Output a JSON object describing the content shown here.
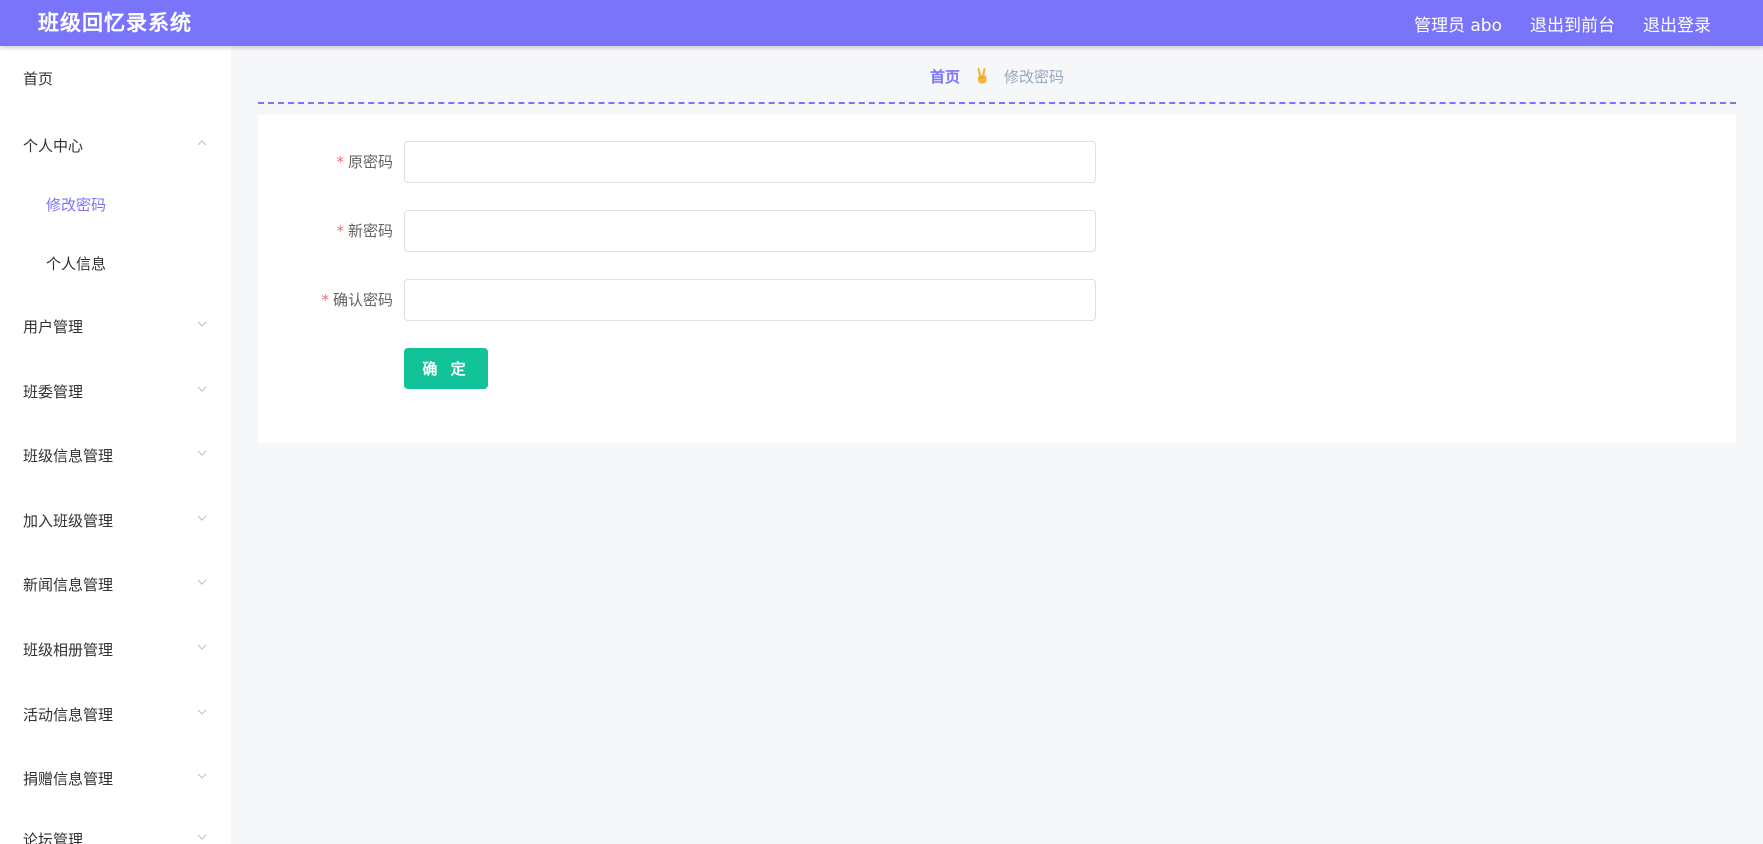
{
  "header": {
    "title": "班级回忆录系统",
    "user": "管理员 abo",
    "front_link": "退出到前台",
    "logout": "退出登录"
  },
  "sidebar": {
    "items": [
      {
        "label": "首页"
      },
      {
        "label": "个人中心",
        "expanded": true
      },
      {
        "label": "修改密码",
        "active": true
      },
      {
        "label": "个人信息"
      },
      {
        "label": "用户管理"
      },
      {
        "label": "班委管理"
      },
      {
        "label": "班级信息管理"
      },
      {
        "label": "加入班级管理"
      },
      {
        "label": "新闻信息管理"
      },
      {
        "label": "班级相册管理"
      },
      {
        "label": "活动信息管理"
      },
      {
        "label": "捐赠信息管理"
      },
      {
        "label": "论坛管理"
      }
    ]
  },
  "breadcrumb": {
    "home": "首页",
    "separator_icon": "victory-hand-icon",
    "current": "修改密码"
  },
  "form": {
    "required_mark": "*",
    "fields": [
      {
        "label": "原密码",
        "value": ""
      },
      {
        "label": "新密码",
        "value": ""
      },
      {
        "label": "确认密码",
        "value": ""
      }
    ],
    "submit_label": "确 定"
  },
  "colors": {
    "accent": "#7a74fb",
    "submit": "#12c39a",
    "required": "#f56c6c"
  }
}
